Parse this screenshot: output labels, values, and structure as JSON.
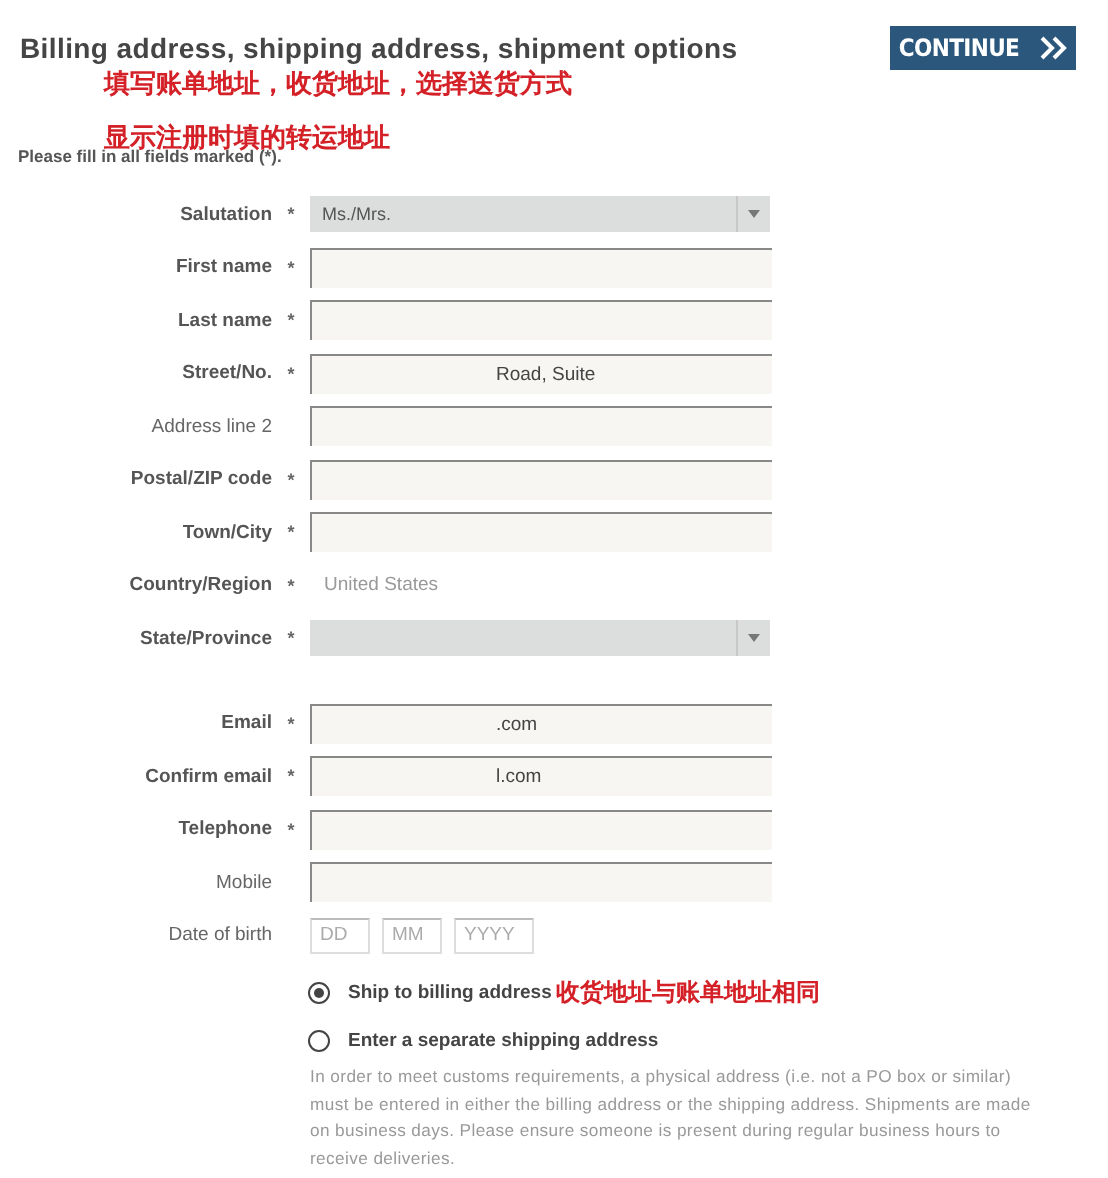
{
  "header": {
    "title": "Billing address, shipping address, shipment options",
    "continue_button": "CONTINUE",
    "annotations": [
      "填写账单地址，收货地址，选择送货方式",
      "显示注册时填的转运地址"
    ]
  },
  "hint": "Please fill in all fields marked (*).",
  "fields": [
    {
      "kind": "select",
      "label": "Salutation",
      "marker": "*",
      "value": "Ms./Mrs."
    },
    {
      "kind": "input",
      "label": "First name",
      "marker": "*"
    },
    {
      "kind": "input",
      "label": "Last name",
      "marker": "*"
    },
    {
      "kind": "input",
      "label": "Street/No.",
      "marker": "*",
      "value": "Road, Suite"
    },
    {
      "kind": "input",
      "label": "Address line 2"
    },
    {
      "kind": "input",
      "label": "Postal/ZIP code",
      "marker": "*"
    },
    {
      "kind": "input",
      "label": "Town/City",
      "marker": "*"
    },
    {
      "kind": "static",
      "label": "Country/Region",
      "marker": "*",
      "value": "United States"
    },
    {
      "kind": "select",
      "label": "State/Province",
      "marker": "*"
    },
    {
      "kind": "gap"
    },
    {
      "kind": "input",
      "label": "Email",
      "marker": "*",
      "value": ".com"
    },
    {
      "kind": "input",
      "label": "Confirm email",
      "marker": "*",
      "value": "l.com"
    },
    {
      "kind": "input",
      "label": "Telephone",
      "marker": "*"
    },
    {
      "kind": "input",
      "label": "Mobile"
    },
    {
      "kind": "date",
      "label": "Date of birth",
      "placeholders": [
        "DD",
        "MM",
        "YYYY"
      ]
    }
  ],
  "shipping_options": [
    {
      "label": "Ship to billing address",
      "selected": true,
      "annotation": "收货地址与账单地址相同"
    },
    {
      "label": "Enter a separate shipping address",
      "selected": false
    }
  ],
  "notice": "In order to meet customs requirements, a physical address (i.e. not a PO box or similar) must be entered in either the billing address or the shipping address. Shipments are made on business days. Please ensure someone is present during regular business hours to receive deliveries."
}
